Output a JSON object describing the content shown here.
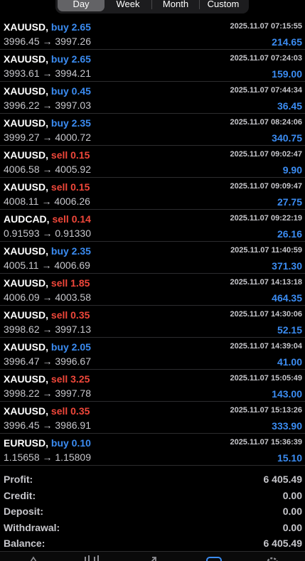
{
  "period_tabs": [
    "Day",
    "Week",
    "Month",
    "Custom"
  ],
  "active_period": "Day",
  "deals": [
    {
      "symbol": "XAUUSD,",
      "side": "buy 2.65",
      "type": "buy",
      "time": "2025.11.07 07:15:55",
      "open": "3996.45",
      "arrow": "→",
      "close": "3997.26",
      "profit": "214.65"
    },
    {
      "symbol": "XAUUSD,",
      "side": "buy 2.65",
      "type": "buy",
      "time": "2025.11.07 07:24:03",
      "open": "3993.61",
      "arrow": "→",
      "close": "3994.21",
      "profit": "159.00"
    },
    {
      "symbol": "XAUUSD,",
      "side": "buy 0.45",
      "type": "buy",
      "time": "2025.11.07 07:44:34",
      "open": "3996.22",
      "arrow": "→",
      "close": "3997.03",
      "profit": "36.45"
    },
    {
      "symbol": "XAUUSD,",
      "side": "buy 2.35",
      "type": "buy",
      "time": "2025.11.07 08:24:06",
      "open": "3999.27",
      "arrow": "→",
      "close": "4000.72",
      "profit": "340.75"
    },
    {
      "symbol": "XAUUSD,",
      "side": "sell 0.15",
      "type": "sell",
      "time": "2025.11.07 09:02:47",
      "open": "4006.58",
      "arrow": "→",
      "close": "4005.92",
      "profit": "9.90"
    },
    {
      "symbol": "XAUUSD,",
      "side": "sell 0.15",
      "type": "sell",
      "time": "2025.11.07 09:09:47",
      "open": "4008.11",
      "arrow": "→",
      "close": "4006.26",
      "profit": "27.75"
    },
    {
      "symbol": "AUDCAD,",
      "side": "sell 0.14",
      "type": "sell",
      "time": "2025.11.07 09:22:19",
      "open": "0.91593",
      "arrow": "→",
      "close": "0.91330",
      "profit": "26.16"
    },
    {
      "symbol": "XAUUSD,",
      "side": "buy 2.35",
      "type": "buy",
      "time": "2025.11.07 11:40:59",
      "open": "4005.11",
      "arrow": "→",
      "close": "4006.69",
      "profit": "371.30"
    },
    {
      "symbol": "XAUUSD,",
      "side": "sell 1.85",
      "type": "sell",
      "time": "2025.11.07 14:13:18",
      "open": "4006.09",
      "arrow": "→",
      "close": "4003.58",
      "profit": "464.35"
    },
    {
      "symbol": "XAUUSD,",
      "side": "sell 0.35",
      "type": "sell",
      "time": "2025.11.07 14:30:06",
      "open": "3998.62",
      "arrow": "→",
      "close": "3997.13",
      "profit": "52.15"
    },
    {
      "symbol": "XAUUSD,",
      "side": "buy 2.05",
      "type": "buy",
      "time": "2025.11.07 14:39:04",
      "open": "3996.47",
      "arrow": "→",
      "close": "3996.67",
      "profit": "41.00"
    },
    {
      "symbol": "XAUUSD,",
      "side": "sell 3.25",
      "type": "sell",
      "time": "2025.11.07 15:05:49",
      "open": "3998.22",
      "arrow": "→",
      "close": "3997.78",
      "profit": "143.00"
    },
    {
      "symbol": "XAUUSD,",
      "side": "sell 0.35",
      "type": "sell",
      "time": "2025.11.07 15:13:26",
      "open": "3996.45",
      "arrow": "→",
      "close": "3986.91",
      "profit": "333.90"
    },
    {
      "symbol": "EURUSD,",
      "side": "buy 0.10",
      "type": "buy",
      "time": "2025.11.07 15:36:39",
      "open": "1.15658",
      "arrow": "→",
      "close": "1.15809",
      "profit": "15.10"
    }
  ],
  "summary": [
    {
      "label": "Profit:",
      "value": "6 405.49"
    },
    {
      "label": "Credit:",
      "value": "0.00"
    },
    {
      "label": "Deposit:",
      "value": "0.00"
    },
    {
      "label": "Withdrawal:",
      "value": "0.00"
    },
    {
      "label": "Balance:",
      "value": "6 405.49"
    }
  ],
  "tab_icons": [
    "quotes-icon",
    "chart-icon",
    "trade-icon",
    "history-icon",
    "settings-icon"
  ],
  "active_tab_icon": "history-icon",
  "colors": {
    "buy": "#3b8cf2",
    "sell": "#f0473a",
    "profit": "#3b8cf2",
    "background": "#000000"
  }
}
